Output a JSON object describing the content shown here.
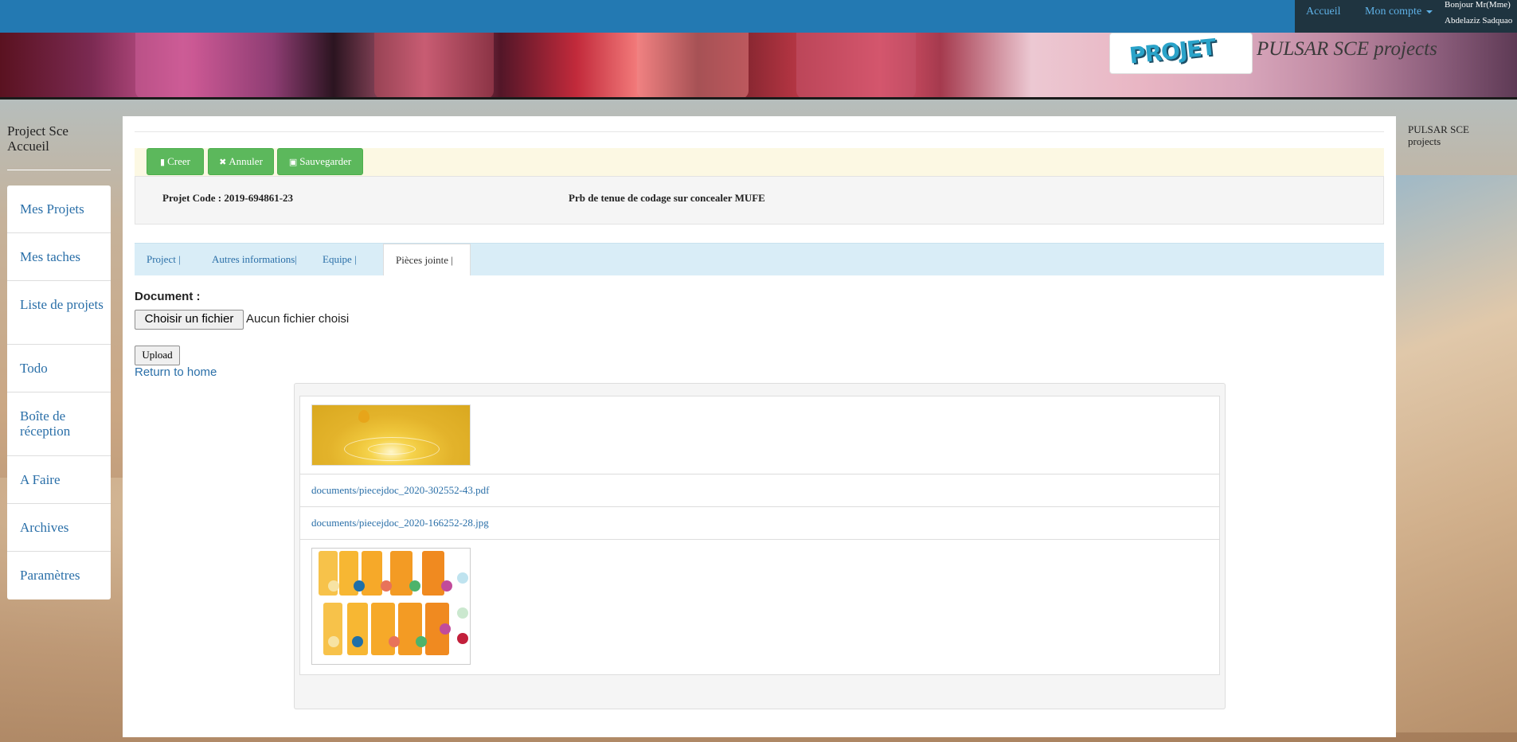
{
  "nav": {
    "home": "Accueil",
    "account": "Mon compte",
    "greeting_line1": "Bonjour Mr(Mme)",
    "greeting_line2": "Abdelaziz Sadquao"
  },
  "banner": {
    "logo_text": "PROJET",
    "brand": "PULSAR SCE projects"
  },
  "sidebar": {
    "title": "Project Sce Accueil",
    "items": [
      {
        "label": "Mes Projets"
      },
      {
        "label": "Mes taches"
      },
      {
        "label": "Liste de projets"
      },
      {
        "label": "Todo"
      },
      {
        "label": "Boîte de réception"
      },
      {
        "label": "A Faire"
      },
      {
        "label": "Archives"
      },
      {
        "label": "Paramètres"
      }
    ]
  },
  "right_panel": {
    "text": "PULSAR SCE projects"
  },
  "toolbar": {
    "create": "Creer",
    "cancel": "Annuler",
    "save": "Sauvegarder"
  },
  "project": {
    "code_label": "Projet Code : 2019-694861-23",
    "title": "Prb de tenue de codage sur concealer MUFE"
  },
  "tabs": [
    {
      "label": "Project |",
      "active": false
    },
    {
      "label": "Autres informations|",
      "active": false
    },
    {
      "label": "Equipe |",
      "active": false
    },
    {
      "label": "Pièces jointe |",
      "active": true
    }
  ],
  "upload_form": {
    "document_label": "Document :",
    "file_button": "Choisir un fichier",
    "file_status": "Aucun fichier choisi",
    "upload_button": "Upload",
    "return_link": "Return to home"
  },
  "attachments": [
    {
      "type": "image",
      "preview": "gold-drop-image"
    },
    {
      "type": "link",
      "text": "documents/piecejdoc_2020-302552-43.pdf"
    },
    {
      "type": "link",
      "text": "documents/piecejdoc_2020-166252-28.jpg"
    },
    {
      "type": "image",
      "preview": "process-flow-diagram"
    }
  ],
  "colors": {
    "navbar": "#2379b2",
    "success": "#5cb85c",
    "link": "#2a6fa8",
    "tabs_bg": "#d9edf7"
  }
}
